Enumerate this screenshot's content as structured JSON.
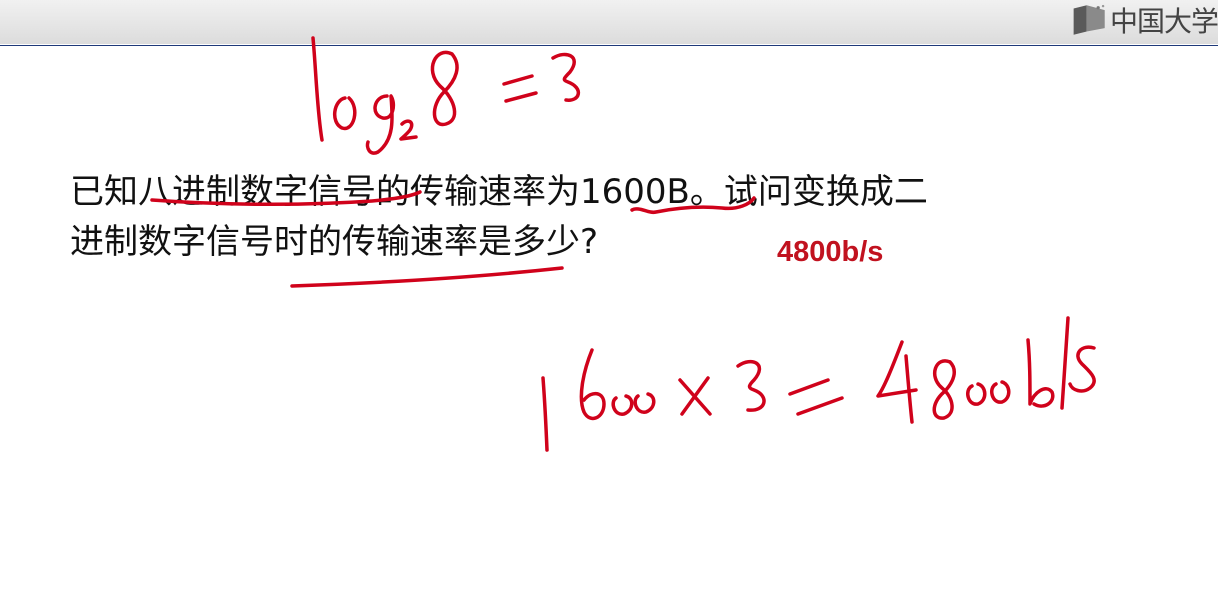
{
  "header": {
    "logo_text": "中国大学",
    "accent_color": "#1f3a7a"
  },
  "question": {
    "line1": "已知八进制数字信号的传输速率为1600B。试问变换成二",
    "line2": "进制数字信号时的传输速率是多少?"
  },
  "answer": {
    "text": "4800b/s",
    "color": "#c1121f"
  },
  "annotations": {
    "ink_color": "#d0021b",
    "handwritten_formula_top": "log₂8 = 3",
    "handwritten_formula_bottom": "1600 × 3 = 4800b/s"
  }
}
